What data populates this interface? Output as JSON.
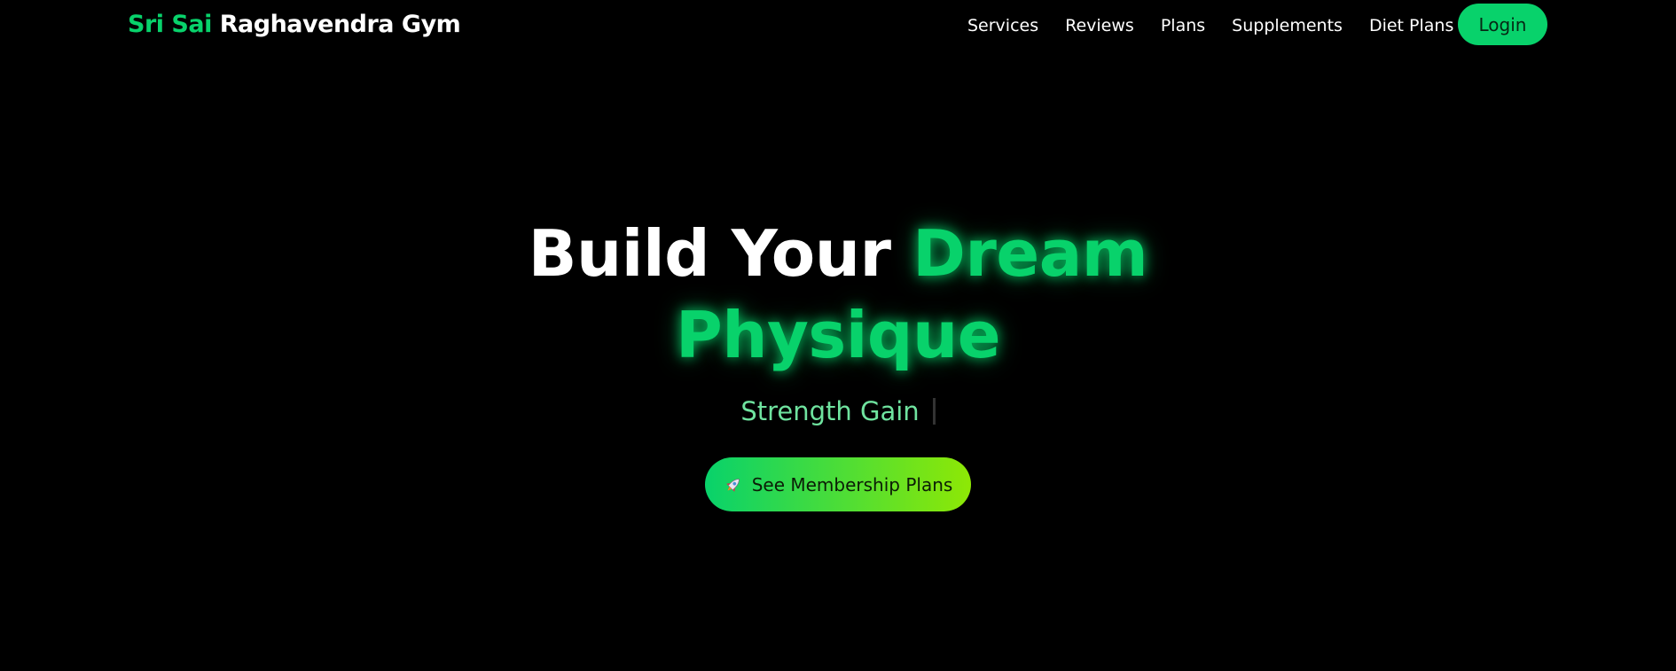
{
  "brand": {
    "accent": "Sri Sai",
    "rest": "Raghavendra Gym"
  },
  "nav": {
    "links": [
      "Services",
      "Reviews",
      "Plans",
      "Supplements",
      "Diet Plans"
    ],
    "login": "Login"
  },
  "hero": {
    "title_white": "Build Your",
    "title_green_1": "Dream",
    "title_green_2": "Physique",
    "subtitle": "Strength Gain",
    "cta_label": "See Membership Plans",
    "cta_icon": "rocket-icon"
  },
  "colors": {
    "background": "#000000",
    "accent": "#08d26b",
    "subtitle": "#6fe39f",
    "cta_gradient_start": "#08d26b",
    "cta_gradient_end": "#8ee805"
  }
}
